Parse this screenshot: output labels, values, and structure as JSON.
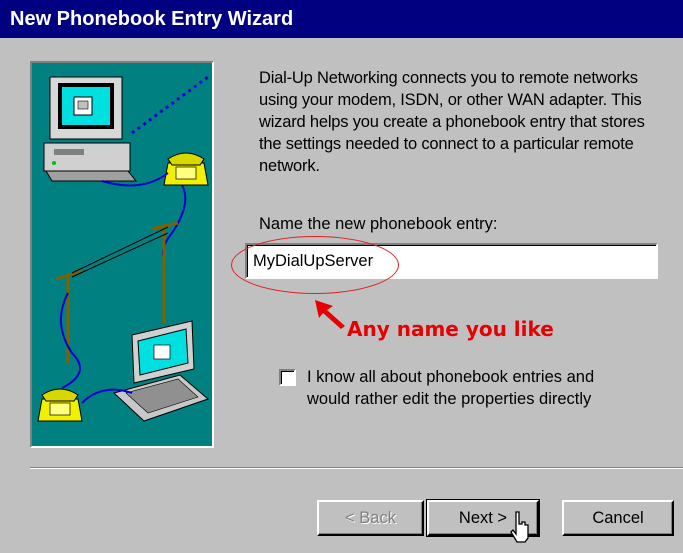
{
  "window": {
    "title": "New Phonebook Entry Wizard"
  },
  "intro": "Dial-Up Networking connects you to remote networks\nusing your modem, ISDN, or other WAN adapter.  This\nwizard helps you create a phonebook entry that stores\nthe settings needed to connect to a particular remote\nnetwork.",
  "name_field": {
    "label": "Name the new phonebook entry:",
    "value": "MyDialUpServer"
  },
  "annotation": {
    "text": "Any name you like",
    "color": "#e60000"
  },
  "checkbox": {
    "label": "I know all about phonebook entries and\nwould rather edit the properties directly",
    "checked": false
  },
  "buttons": {
    "back": "< Back",
    "next": "Next >",
    "cancel": "Cancel"
  },
  "colors": {
    "titlebar": "#000080",
    "dialog_bg": "#c0c0c0",
    "picture_bg": "#008080"
  }
}
